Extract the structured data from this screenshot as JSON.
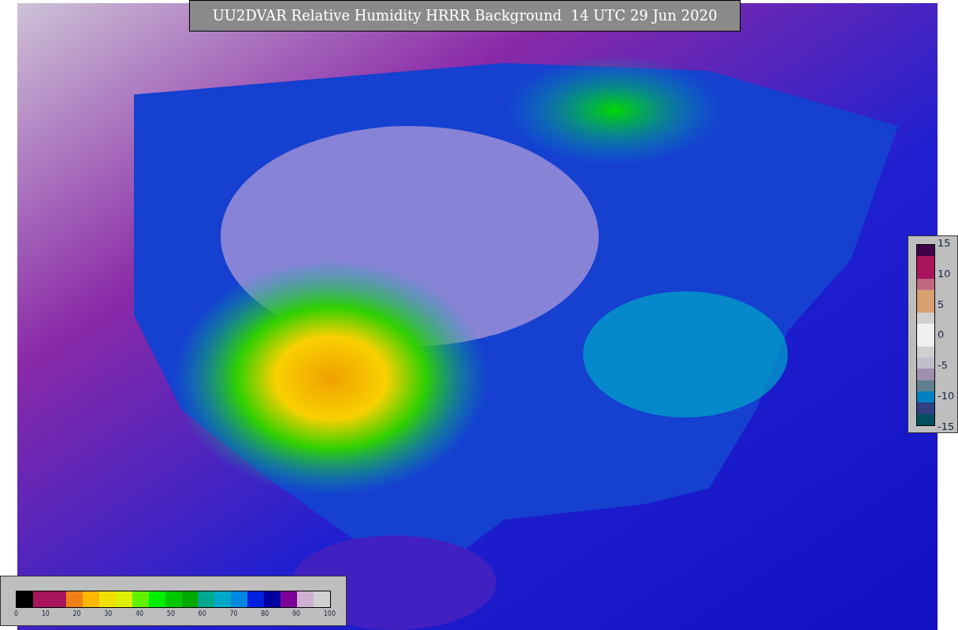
{
  "title": "UU2DVAR Relative Humidity HRRR Background  14 UTC 29 Jun 2020",
  "humidity_legend": {
    "segments": [
      {
        "color": "#000000"
      },
      {
        "color": "#a8155c"
      },
      {
        "color": "#a8155c"
      },
      {
        "color": "#f08018"
      },
      {
        "color": "#fcb800"
      },
      {
        "color": "#f0e000"
      },
      {
        "color": "#dcf000"
      },
      {
        "color": "#60f000"
      },
      {
        "color": "#00ee00"
      },
      {
        "color": "#00c800"
      },
      {
        "color": "#00a800"
      },
      {
        "color": "#00a890"
      },
      {
        "color": "#00a8c8"
      },
      {
        "color": "#0088e0"
      },
      {
        "color": "#0020e0"
      },
      {
        "color": "#0000a0"
      },
      {
        "color": "#7a0098"
      },
      {
        "color": "#d0b0d0"
      },
      {
        "color": "#d0d0d0"
      }
    ],
    "ticks": [
      "0",
      "10",
      "20",
      "30",
      "40",
      "50",
      "60",
      "70",
      "80",
      "90",
      "100"
    ]
  },
  "difference_legend": {
    "segments": [
      {
        "color": "#400048"
      },
      {
        "color": "#a8155c"
      },
      {
        "color": "#a8155c"
      },
      {
        "color": "#c06880"
      },
      {
        "color": "#d8a070"
      },
      {
        "color": "#d8a070"
      },
      {
        "color": "#d0d0d0"
      },
      {
        "color": "#f0f0f0"
      },
      {
        "color": "#f0f0f0"
      },
      {
        "color": "#d0d0d0"
      },
      {
        "color": "#c0bec8"
      },
      {
        "color": "#a090b0"
      },
      {
        "color": "#608090"
      },
      {
        "color": "#0080c0"
      },
      {
        "color": "#304080"
      },
      {
        "color": "#005060"
      }
    ],
    "ticks": [
      "15",
      "10",
      "5",
      "0",
      "-5",
      "-10",
      "-15"
    ]
  }
}
